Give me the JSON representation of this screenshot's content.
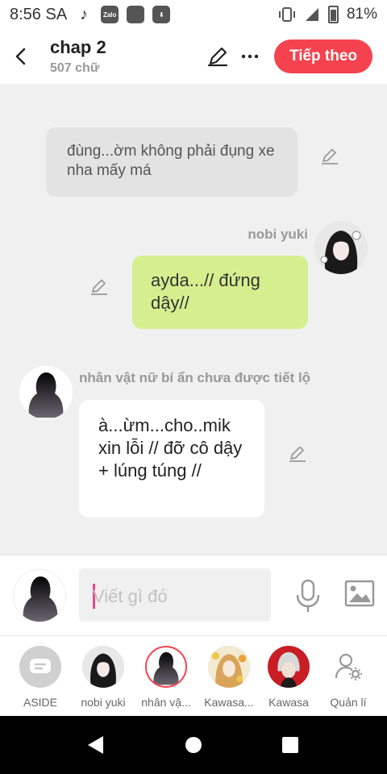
{
  "status": {
    "time": "8:56 SA",
    "apps": [
      "tiktok-icon",
      "zalo-icon",
      "app-icon",
      "download-icon"
    ],
    "zalo_label": "Zalo",
    "battery": "81%"
  },
  "header": {
    "title": "chap 2",
    "word_count": "507 chữ",
    "next_label": "Tiếp theo"
  },
  "chat": {
    "narration": "đùng...ờm không phải đụng xe nha mấy má",
    "my_name": "nobi yuki",
    "my_message": "ayda...// đứng dậy//",
    "other_name": "nhân vật nữ bí ẩn chưa được tiết lộ",
    "other_message": "à...ừm...cho..mik xin lỗi // đỡ cô dậy + lúng túng //"
  },
  "input": {
    "placeholder": "Viết gì đó"
  },
  "characters": [
    {
      "label": "ASIDE"
    },
    {
      "label": "nobi yuki"
    },
    {
      "label": "nhân vậ..."
    },
    {
      "label": "Kawasa..."
    },
    {
      "label": "Kawasa"
    },
    {
      "label": "Quản lí"
    }
  ],
  "colors": {
    "accent": "#f4434f",
    "my_bubble": "#d6ef8e",
    "narration_bubble": "#e3e3e3",
    "caret": "#e8478a"
  }
}
